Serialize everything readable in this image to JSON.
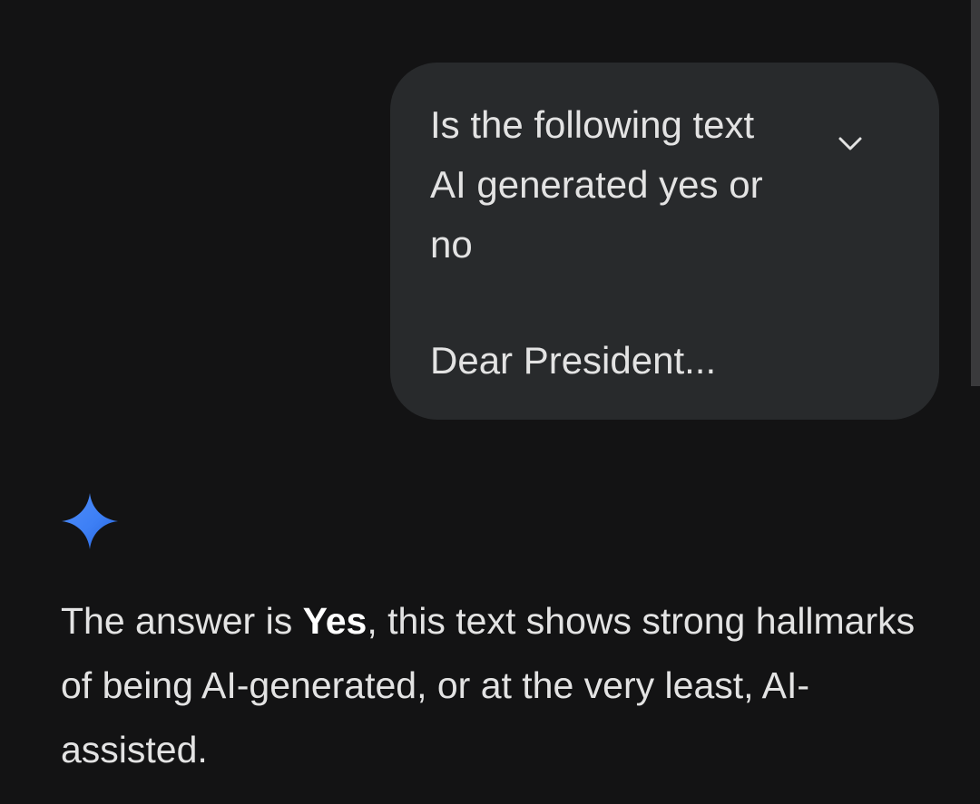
{
  "user_message": {
    "prompt_text": "Is the following text\nAI generated yes or\nno",
    "preview_text": "Dear President...",
    "expand_icon": "chevron-down-icon"
  },
  "assistant": {
    "logo_icon": "gemini-spark-icon",
    "response_prefix": "The answer is ",
    "response_bold": "Yes",
    "response_suffix": ", this text shows strong hallmarks of being AI-generated, or at the very least, AI-assisted."
  },
  "colors": {
    "background": "#131314",
    "bubble": "#282a2c",
    "text": "#e3e3e3",
    "accent_blue": "#4285f4"
  }
}
